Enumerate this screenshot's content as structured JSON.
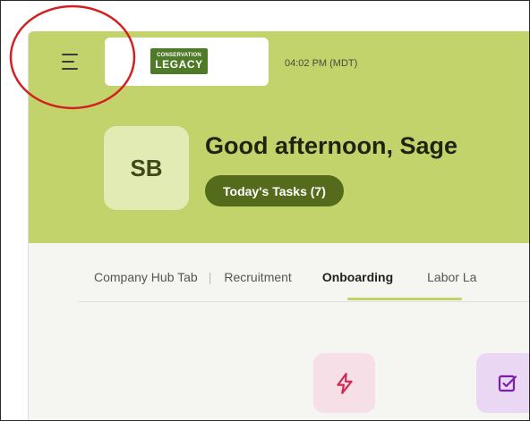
{
  "header": {
    "logo": {
      "line1": "CONSERVATION",
      "line2": "LEGACY"
    },
    "time": "04:02 PM (MDT)"
  },
  "greeting": {
    "avatar_initials": "SB",
    "text": "Good afternoon, Sage",
    "tasks_label": "Today's Tasks (7)"
  },
  "tabs": {
    "items": [
      "Company Hub Tab",
      "Recruitment",
      "Onboarding",
      "Labor La"
    ],
    "separator": "|",
    "active": "Onboarding"
  },
  "icons": {
    "menu": "hamburger-menu-icon",
    "card1": "lightning-bolt-icon",
    "card2": "edit-checkbox-icon"
  },
  "colors": {
    "brand": "#c2d36c",
    "pill": "#556b1c",
    "avatar_bg": "#e2ebb4",
    "logo_green": "#4f7a28",
    "annotation": "#d42020"
  }
}
